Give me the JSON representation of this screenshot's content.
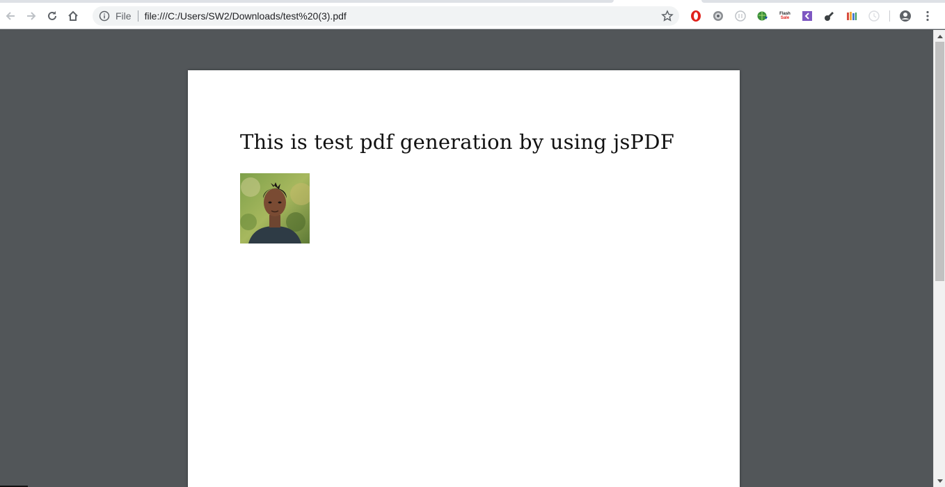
{
  "browser": {
    "address_bar": {
      "scheme_label": "File",
      "url": "file:///C:/Users/SW2/Downloads/test%20(3).pdf"
    },
    "nav_icons": [
      "arrow-back-icon",
      "arrow-forward-icon",
      "reload-icon",
      "home-icon"
    ],
    "extensions": [
      "opera-icon",
      "gear-extension-icon",
      "circle-extension-icon",
      "globe-download-icon",
      "flash-sale-icon",
      "kotlin-icon",
      "pen-icon",
      "books-icon",
      "clock-extension-icon"
    ],
    "flash_sale": {
      "line1": "Flash",
      "line2": "Sale"
    },
    "colors": {
      "toolbar": "#ffffff",
      "omnibox": "#f1f3f4",
      "viewer_bg": "#525659",
      "opera_red": "#e0211b",
      "kotlin_purple": "#7e57c2"
    }
  },
  "pdf": {
    "title": "This is test pdf generation by using jsPDF",
    "image": "portrait-photo"
  }
}
